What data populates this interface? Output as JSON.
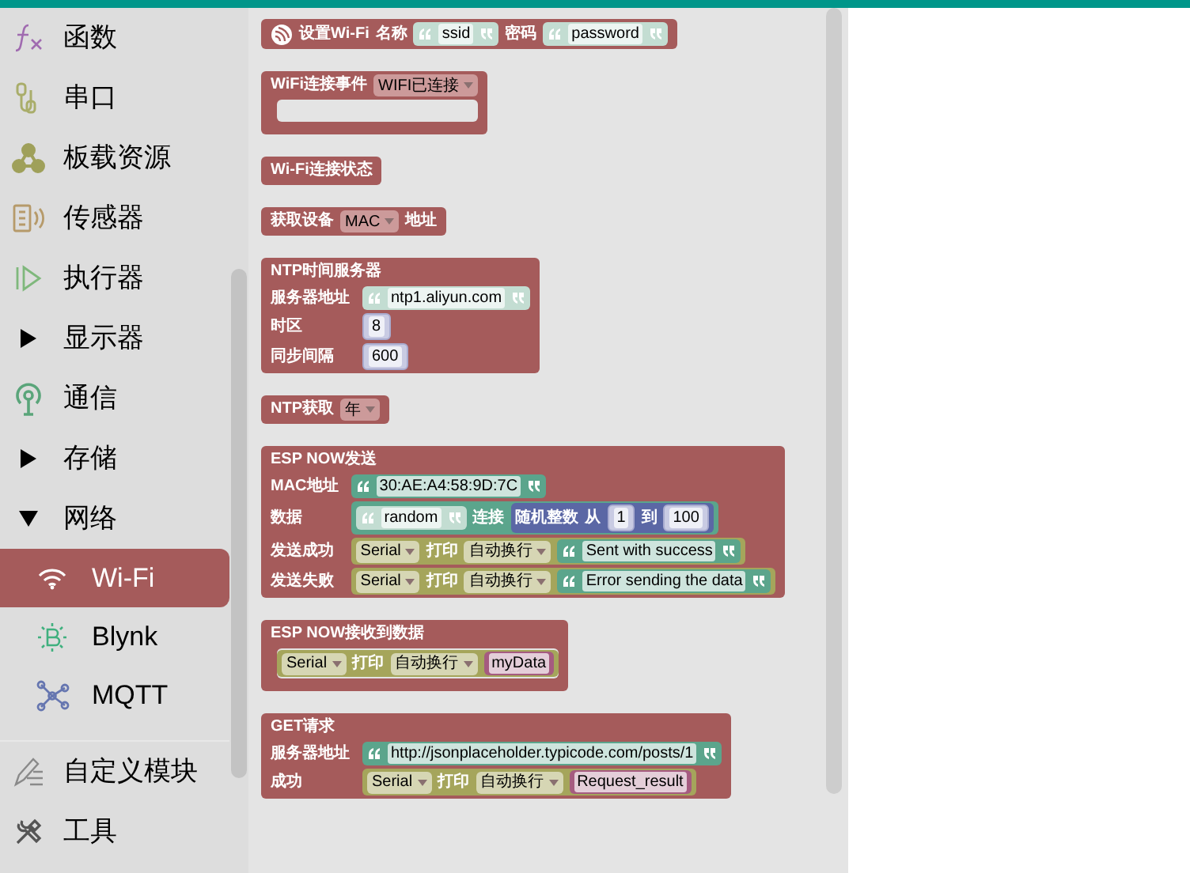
{
  "sidebar": {
    "sections": [
      {
        "categories": [
          {
            "label": "函数",
            "kind": "function",
            "selected": false
          },
          {
            "label": "串口",
            "kind": "serial",
            "selected": false
          },
          {
            "label": "板载资源",
            "kind": "board",
            "selected": false
          },
          {
            "label": "传感器",
            "kind": "sensor",
            "selected": false
          },
          {
            "label": "执行器",
            "kind": "actuator",
            "selected": false
          },
          {
            "label": "显示器",
            "kind": "folder",
            "expanded": false,
            "selected": false
          },
          {
            "label": "通信",
            "kind": "antenna",
            "selected": false
          },
          {
            "label": "存储",
            "kind": "folder",
            "expanded": false,
            "selected": false
          },
          {
            "label": "网络",
            "kind": "folder",
            "expanded": true,
            "selected": false,
            "children": [
              {
                "label": "Wi-Fi",
                "kind": "wifi",
                "selected": true
              },
              {
                "label": "Blynk",
                "kind": "blynk",
                "selected": false
              },
              {
                "label": "MQTT",
                "kind": "mqtt",
                "selected": false
              }
            ]
          }
        ]
      },
      {
        "categories": [
          {
            "label": "自定义模块",
            "kind": "pencil",
            "selected": false
          },
          {
            "label": "工具",
            "kind": "tools",
            "selected": false
          }
        ]
      }
    ]
  },
  "flyout": {
    "blocks": [
      {
        "kind": "statement",
        "rows": [
          {
            "parts": [
              {
                "kind": "logo"
              },
              {
                "kind": "label",
                "text": "设置Wi-Fi"
              },
              {
                "kind": "label",
                "text": "名称"
              },
              {
                "kind": "input",
                "block": {
                  "kind": "text_shadow",
                  "parts": [
                    {
                      "kind": "field",
                      "text": "ssid"
                    }
                  ]
                }
              },
              {
                "kind": "label",
                "text": "密码"
              },
              {
                "kind": "input",
                "block": {
                  "kind": "text_shadow",
                  "parts": [
                    {
                      "kind": "field",
                      "text": "password"
                    }
                  ]
                }
              }
            ]
          }
        ]
      },
      {
        "kind": "container",
        "rows": [
          {
            "parts": [
              {
                "kind": "label",
                "text": "WiFi连接事件"
              },
              {
                "kind": "dropdown",
                "text": "WIFI已连接"
              }
            ]
          }
        ]
      },
      {
        "kind": "value",
        "rows": [
          {
            "parts": [
              {
                "kind": "label",
                "text": "Wi-Fi连接状态"
              }
            ]
          }
        ]
      },
      {
        "kind": "value",
        "rows": [
          {
            "parts": [
              {
                "kind": "label",
                "text": "获取设备"
              },
              {
                "kind": "dropdown",
                "text": "MAC"
              },
              {
                "kind": "label",
                "text": "地址"
              }
            ]
          }
        ]
      },
      {
        "kind": "statement",
        "rows": [
          {
            "parts": [
              {
                "kind": "label",
                "text": "NTP时间服务器"
              }
            ]
          },
          {
            "parts": [
              {
                "kind": "label",
                "text": "服务器地址"
              },
              {
                "kind": "input",
                "block": {
                  "kind": "text_shadow",
                  "parts": [
                    {
                      "kind": "field",
                      "text": "ntp1.aliyun.com"
                    }
                  ]
                }
              }
            ]
          },
          {
            "parts": [
              {
                "kind": "label",
                "text": "时区"
              },
              {
                "kind": "input",
                "block": {
                  "kind": "number_shadow",
                  "parts": [
                    {
                      "kind": "field",
                      "text": "8"
                    }
                  ]
                }
              }
            ]
          },
          {
            "parts": [
              {
                "kind": "label",
                "text": "同步间隔"
              },
              {
                "kind": "input",
                "block": {
                  "kind": "number_shadow",
                  "parts": [
                    {
                      "kind": "field",
                      "text": "600"
                    }
                  ]
                }
              }
            ]
          }
        ]
      },
      {
        "kind": "value",
        "rows": [
          {
            "parts": [
              {
                "kind": "label",
                "text": "NTP获取"
              },
              {
                "kind": "dropdown",
                "text": "年"
              }
            ]
          }
        ]
      },
      {
        "kind": "statement",
        "rows": [
          {
            "parts": [
              {
                "kind": "label",
                "text": "ESP NOW发送"
              }
            ]
          },
          {
            "parts": [
              {
                "kind": "label",
                "text": "MAC地址"
              },
              {
                "kind": "input",
                "block": {
                  "kind": "text",
                  "parts": [
                    {
                      "kind": "field",
                      "text": "30:AE:A4:58:9D:7C"
                    }
                  ]
                }
              }
            ]
          },
          {
            "parts": [
              {
                "kind": "label",
                "text": "数据"
              },
              {
                "kind": "input",
                "block": {
                  "kind": "text_join",
                  "parts": [
                    {
                      "kind": "input",
                      "block": {
                        "kind": "text_shadow",
                        "parts": [
                          {
                            "kind": "field",
                            "text": "random"
                          }
                        ]
                      }
                    },
                    {
                      "kind": "label",
                      "text": "连接"
                    },
                    {
                      "kind": "input",
                      "block": {
                        "kind": "math",
                        "parts": [
                          {
                            "kind": "label",
                            "text": "随机整数"
                          },
                          {
                            "kind": "label",
                            "text": "从"
                          },
                          {
                            "kind": "input",
                            "block": {
                              "kind": "number_shadow",
                              "parts": [
                                {
                                  "kind": "field",
                                  "text": "1"
                                }
                              ]
                            }
                          },
                          {
                            "kind": "label",
                            "text": "到"
                          },
                          {
                            "kind": "input",
                            "block": {
                              "kind": "number_shadow",
                              "parts": [
                                {
                                  "kind": "field",
                                  "text": "100"
                                }
                              ]
                            }
                          }
                        ]
                      }
                    }
                  ]
                }
              }
            ]
          },
          {
            "parts": [
              {
                "kind": "label",
                "text": "发送成功"
              },
              {
                "kind": "input",
                "block": {
                  "kind": "serial",
                  "parts": [
                    {
                      "kind": "dropdown",
                      "text": "Serial"
                    },
                    {
                      "kind": "label",
                      "text": "打印"
                    },
                    {
                      "kind": "dropdown",
                      "text": "自动换行"
                    },
                    {
                      "kind": "input",
                      "block": {
                        "kind": "text",
                        "parts": [
                          {
                            "kind": "field",
                            "text": "Sent with success"
                          }
                        ]
                      }
                    }
                  ]
                }
              }
            ]
          },
          {
            "parts": [
              {
                "kind": "label",
                "text": "发送失败"
              },
              {
                "kind": "input",
                "block": {
                  "kind": "serial",
                  "parts": [
                    {
                      "kind": "dropdown",
                      "text": "Serial"
                    },
                    {
                      "kind": "label",
                      "text": "打印"
                    },
                    {
                      "kind": "dropdown",
                      "text": "自动换行"
                    },
                    {
                      "kind": "input",
                      "block": {
                        "kind": "text",
                        "parts": [
                          {
                            "kind": "field",
                            "text": "Error sending the data"
                          }
                        ]
                      }
                    }
                  ]
                }
              }
            ]
          }
        ]
      },
      {
        "kind": "container",
        "rows": [
          {
            "parts": [
              {
                "kind": "label",
                "text": "ESP NOW接收到数据"
              }
            ]
          }
        ],
        "body": [
          {
            "kind": "serial",
            "parts": [
              {
                "kind": "dropdown",
                "text": "Serial"
              },
              {
                "kind": "label",
                "text": "打印"
              },
              {
                "kind": "dropdown",
                "text": "自动换行"
              },
              {
                "kind": "input",
                "block": {
                  "kind": "variable",
                  "parts": [
                    {
                      "kind": "field",
                      "text": "myData"
                    }
                  ]
                }
              }
            ]
          }
        ]
      },
      {
        "kind": "statement",
        "rows": [
          {
            "parts": [
              {
                "kind": "label",
                "text": "GET请求"
              }
            ]
          },
          {
            "parts": [
              {
                "kind": "label",
                "text": "服务器地址"
              },
              {
                "kind": "input",
                "block": {
                  "kind": "text",
                  "parts": [
                    {
                      "kind": "field",
                      "text": "http://jsonplaceholder.typicode.com/posts/1"
                    }
                  ]
                }
              }
            ]
          },
          {
            "parts": [
              {
                "kind": "label",
                "text": "成功"
              },
              {
                "kind": "input",
                "block": {
                  "kind": "serial",
                  "parts": [
                    {
                      "kind": "dropdown",
                      "text": "Serial"
                    },
                    {
                      "kind": "label",
                      "text": "打印"
                    },
                    {
                      "kind": "dropdown",
                      "text": "自动换行"
                    },
                    {
                      "kind": "input",
                      "block": {
                        "kind": "variable",
                        "parts": [
                          {
                            "kind": "field",
                            "text": "Request_result"
                          }
                        ]
                      }
                    }
                  ]
                }
              }
            ]
          }
        ]
      }
    ]
  }
}
